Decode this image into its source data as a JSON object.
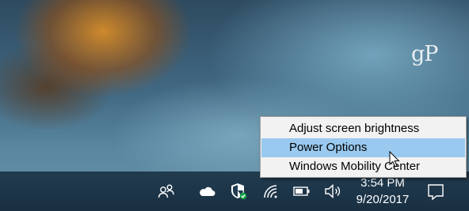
{
  "desktop": {
    "watermark": "gP"
  },
  "context_menu": {
    "items": [
      {
        "label": "Adjust screen brightness",
        "selected": false
      },
      {
        "label": "Power Options",
        "selected": true
      },
      {
        "label": "Windows Mobility Center",
        "selected": false
      }
    ]
  },
  "taskbar": {
    "tray_icons": [
      "people-icon",
      "onedrive-cloud-icon",
      "windows-defender-shield-icon",
      "wifi-icon",
      "battery-icon",
      "volume-icon"
    ],
    "clock": {
      "time": "3:54 PM",
      "date": "9/20/2017"
    },
    "action_center_icon": "notification-icon"
  },
  "colors": {
    "menu_background": "#f2f2f2",
    "menu_highlight": "#99c9ef",
    "taskbar": "#1c3448",
    "text_light": "#ffffff"
  }
}
